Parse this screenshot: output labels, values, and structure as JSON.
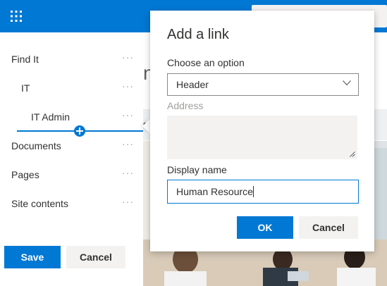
{
  "suite_bar": {
    "app_launcher_icon": "waffle-icon",
    "color": "#0078d4"
  },
  "background_page": {
    "title_fragment": "n",
    "band_fragment": "s"
  },
  "left_nav": {
    "items": [
      {
        "label": "Find It",
        "level": 0
      },
      {
        "label": "IT",
        "level": 1
      },
      {
        "label": "IT Admin",
        "level": 2
      },
      {
        "label": "Documents",
        "level": 0
      },
      {
        "label": "Pages",
        "level": 0
      },
      {
        "label": "Site contents",
        "level": 0
      }
    ],
    "more_glyph": "···",
    "save_label": "Save",
    "cancel_label": "Cancel"
  },
  "dialog": {
    "title": "Add a link",
    "option_label": "Choose an option",
    "option_value": "Header",
    "address_label": "Address",
    "address_value": "",
    "display_name_label": "Display name",
    "display_name_value": "Human Resource",
    "ok_label": "OK",
    "cancel_label": "Cancel"
  },
  "colors": {
    "accent": "#0078d4",
    "neutral_button": "#f3f2f1",
    "text": "#323130",
    "disabled_text": "#a19f9d"
  }
}
